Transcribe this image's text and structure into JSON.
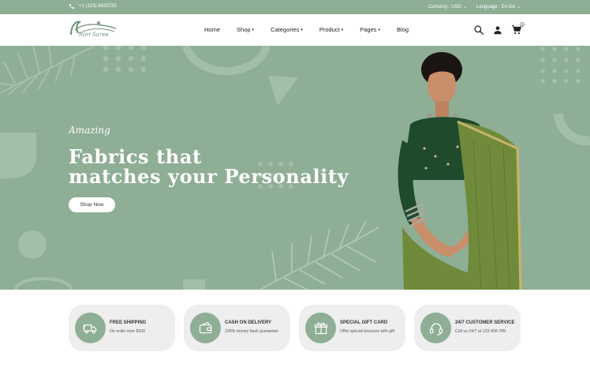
{
  "topbar": {
    "phone": "+1 (123) 8425733",
    "currency_label": "Currency : USD",
    "language_label": "Language : En-Gb"
  },
  "header": {
    "logo_text": "Nari Saree",
    "nav": [
      {
        "label": "Home",
        "has_dropdown": false
      },
      {
        "label": "Shop",
        "has_dropdown": true
      },
      {
        "label": "Categories",
        "has_dropdown": true
      },
      {
        "label": "Product",
        "has_dropdown": true
      },
      {
        "label": "Pages",
        "has_dropdown": true
      },
      {
        "label": "Blog",
        "has_dropdown": false
      }
    ],
    "cart_count": "0"
  },
  "hero": {
    "eyebrow": "Amazing",
    "headline_line1": "Fabrics that",
    "headline_line2": "matches your Personality",
    "cta_label": "Shop Now"
  },
  "features": [
    {
      "icon": "truck-icon",
      "title": "FREE SHIPPING",
      "subtitle": "On order over $150"
    },
    {
      "icon": "wallet-icon",
      "title": "CASH ON DELIVERY",
      "subtitle": "100% money back guarantee"
    },
    {
      "icon": "gift-icon",
      "title": "SPECIAL GIFT CARD",
      "subtitle": "Offer special bonuses with gift"
    },
    {
      "icon": "headset-icon",
      "title": "24/7 CUSTOMER SERVICE",
      "subtitle": "Call us 24/7 at 123-456-789"
    }
  ],
  "colors": {
    "brand": "#8fae96",
    "card_bg": "#eeeeee"
  }
}
